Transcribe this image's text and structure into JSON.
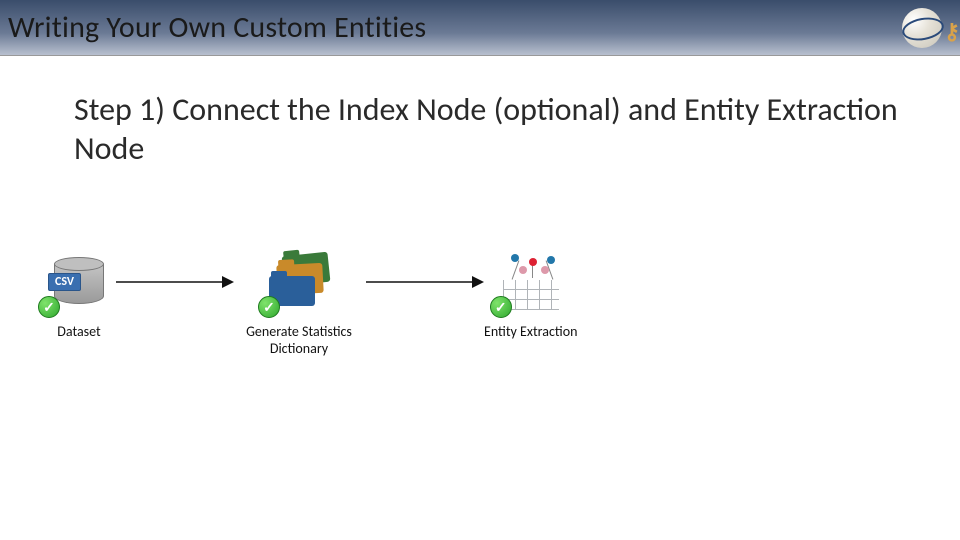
{
  "header": {
    "title": "Writing Your Own Custom Entities"
  },
  "body": {
    "step_text": "Step 1) Connect the Index Node (optional) and Entity Extraction Node"
  },
  "diagram": {
    "nodes": [
      {
        "label": "Dataset",
        "badge": "✓",
        "csv_tag": "CSV"
      },
      {
        "label": "Generate Statistics Dictionary",
        "badge": "✓"
      },
      {
        "label": "Entity Extraction",
        "badge": "✓"
      }
    ]
  }
}
